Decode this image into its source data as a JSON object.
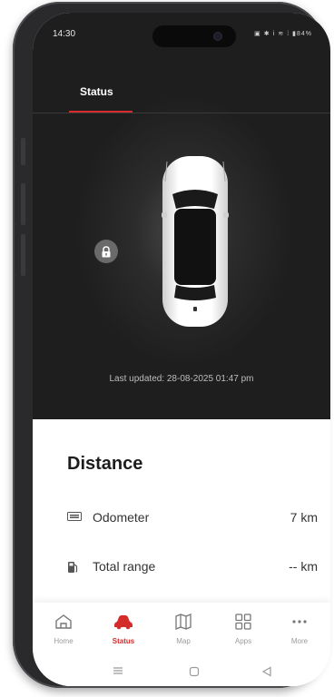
{
  "status_bar": {
    "time": "14:30",
    "system_icons": "▣ ✱ ⅰ ≋ ⁞ ▮84%"
  },
  "header": {
    "tab_label": "Status"
  },
  "vehicle": {
    "last_updated": "Last updated: 28-08-2025 01:47 pm"
  },
  "distance": {
    "title": "Distance",
    "rows": [
      {
        "label": "Odometer",
        "value": "7 km",
        "icon": "odometer-icon"
      },
      {
        "label": "Total range",
        "value": "-- km",
        "icon": "fuel-pump-icon"
      }
    ]
  },
  "bottom_nav": {
    "items": [
      {
        "label": "Home",
        "icon": "home-icon"
      },
      {
        "label": "Status",
        "icon": "car-icon"
      },
      {
        "label": "Map",
        "icon": "map-icon"
      },
      {
        "label": "Apps",
        "icon": "apps-icon"
      },
      {
        "label": "More",
        "icon": "more-icon"
      }
    ],
    "active_index": 1
  },
  "colors": {
    "accent": "#d42b2b",
    "dark_bg": "#1e1e1e",
    "text": "#1d1d1d"
  }
}
